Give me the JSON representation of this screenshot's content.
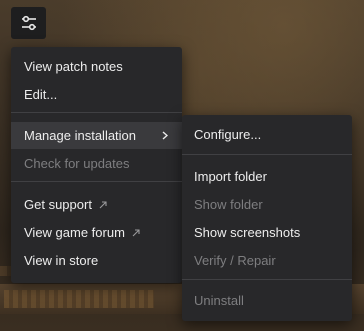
{
  "colors": {
    "menu_bg": "#28282a",
    "item_text": "#ededed",
    "disabled_text": "#7e7e80",
    "active_bg": "#3a3a3d",
    "separator": "#404043"
  },
  "settings_button": {
    "icon": "sliders-icon"
  },
  "main_menu": {
    "view_patch_notes": "View patch notes",
    "edit": "Edit...",
    "manage_installation": "Manage installation",
    "check_for_updates": "Check for updates",
    "get_support": "Get support",
    "view_game_forum": "View game forum",
    "view_in_store": "View in store"
  },
  "submenu": {
    "configure": "Configure...",
    "import_folder": "Import folder",
    "show_folder": "Show folder",
    "show_screenshots": "Show screenshots",
    "verify_repair": "Verify / Repair",
    "uninstall": "Uninstall"
  }
}
